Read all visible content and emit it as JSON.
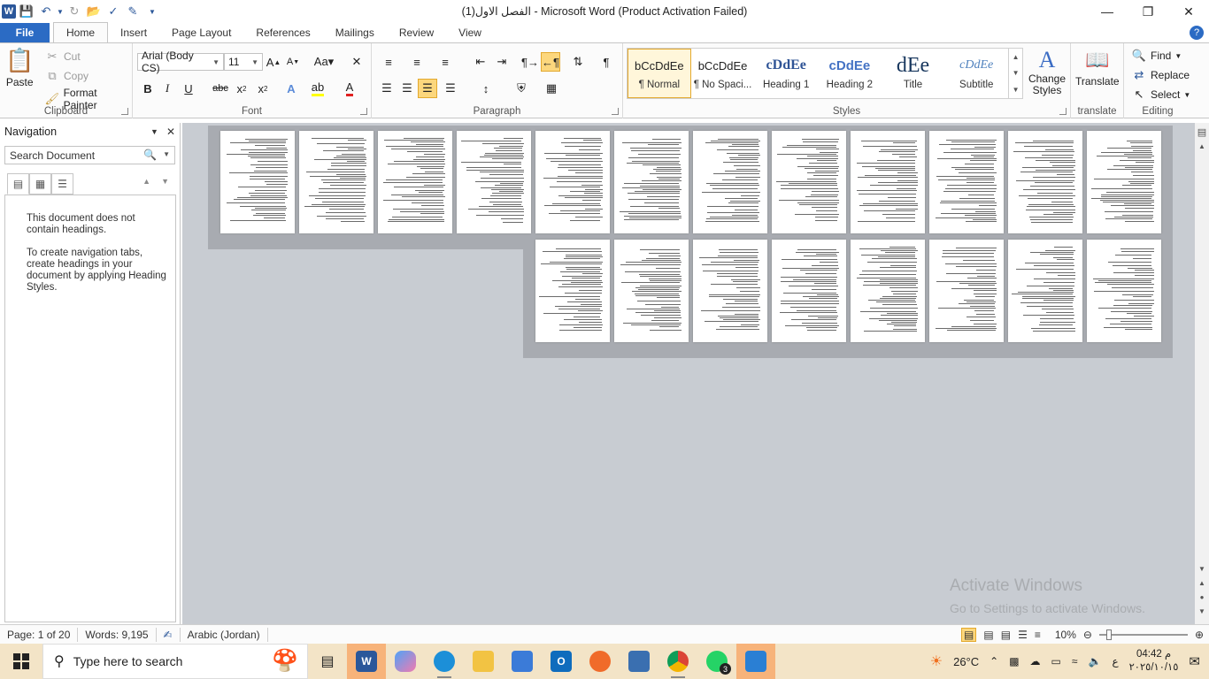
{
  "window": {
    "title": "الفصل الاول(1)  -  Microsoft Word (Product Activation Failed)",
    "qat_icons": [
      "word-logo-icon",
      "save-icon",
      "undo-icon",
      "redo-icon",
      "open-icon",
      "spellcheck-icon",
      "track-changes-icon",
      "customize-qat-icon"
    ]
  },
  "tabs": [
    "File",
    "Home",
    "Insert",
    "Page Layout",
    "References",
    "Mailings",
    "Review",
    "View"
  ],
  "active_tab": "Home",
  "clipboard": {
    "paste": "Paste",
    "cut": "Cut",
    "copy": "Copy",
    "format_painter": "Format Painter",
    "label": "Clipboard"
  },
  "font": {
    "name": "Arial (Body CS)",
    "size": "11",
    "label": "Font"
  },
  "paragraph": {
    "label": "Paragraph"
  },
  "styles": {
    "items": [
      {
        "preview": "bCcDdEe",
        "name": "¶ Normal",
        "selected": true
      },
      {
        "preview": "bCcDdEe",
        "name": "¶ No Spaci...",
        "selected": false
      },
      {
        "preview": "cDdEe",
        "name": "Heading 1",
        "selected": false
      },
      {
        "preview": "cDdEe",
        "name": "Heading 2",
        "selected": false
      },
      {
        "preview": "dEe",
        "name": "Title",
        "selected": false
      },
      {
        "preview": "cDdEe",
        "name": "Subtitle",
        "selected": false
      }
    ],
    "change_styles": "Change Styles",
    "label": "Styles"
  },
  "translate": {
    "button": "Translate",
    "label": "translate"
  },
  "editing": {
    "find": "Find",
    "replace": "Replace",
    "select": "Select",
    "label": "Editing"
  },
  "navigation": {
    "title": "Navigation",
    "search_placeholder": "Search Document",
    "message1": "This document does not contain headings.",
    "message2": "To create navigation tabs, create headings in your document by applying Heading Styles."
  },
  "watermark": {
    "line1": "Activate Windows",
    "line2": "Go to Settings to activate Windows."
  },
  "statusbar": {
    "page": "Page: 1 of 20",
    "words": "Words: 9,195",
    "language": "Arabic (Jordan)",
    "zoom": "10%"
  },
  "taskbar": {
    "search_placeholder": "Type here to search",
    "temperature": "26°C",
    "keyboard_lang": "ع",
    "time": "04:42 م",
    "date": "٢٠٢٥/١٠/١٥",
    "chat_badge": "3"
  },
  "colors": {
    "accent": "#2b579a",
    "file_tab": "#2b6bc4",
    "doc_bg": "#c8ccd2",
    "taskbar": "#f3e4c7"
  }
}
